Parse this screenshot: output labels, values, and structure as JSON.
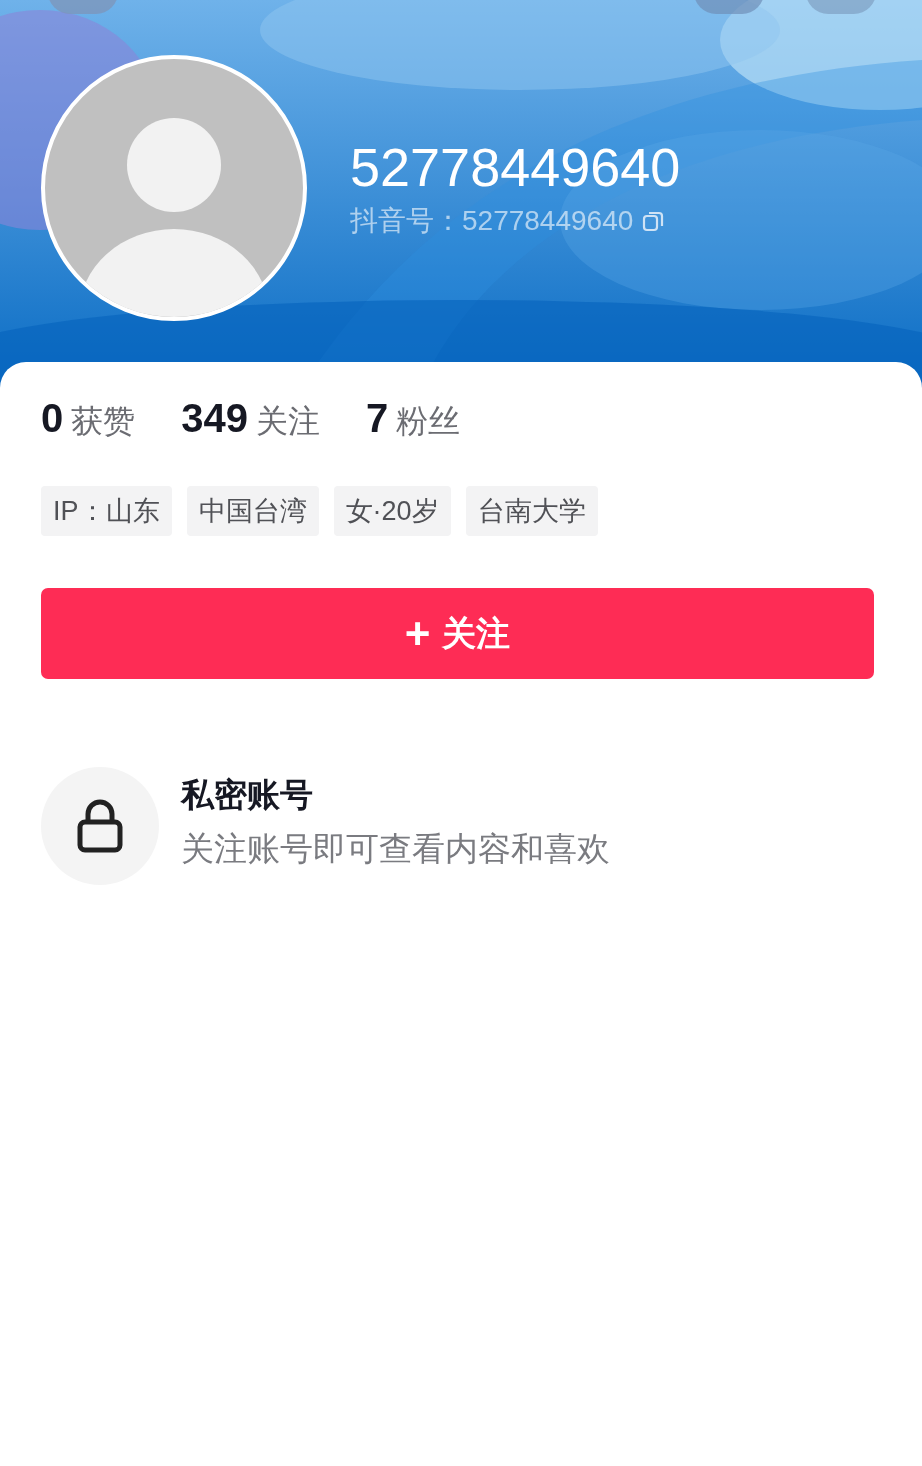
{
  "profile": {
    "name": "52778449640",
    "id_label": "抖音号：52778449640"
  },
  "stats": [
    {
      "count": "0",
      "caption": "获赞"
    },
    {
      "count": "349",
      "caption": "关注"
    },
    {
      "count": "7",
      "caption": "粉丝"
    }
  ],
  "tags": [
    "IP：山东",
    "中国台湾",
    "女·20岁",
    "台南大学"
  ],
  "follow_button": {
    "icon": "+",
    "label": "关注"
  },
  "private_notice": {
    "title": "私密账号",
    "text": "关注账号即可查看内容和喜欢"
  }
}
